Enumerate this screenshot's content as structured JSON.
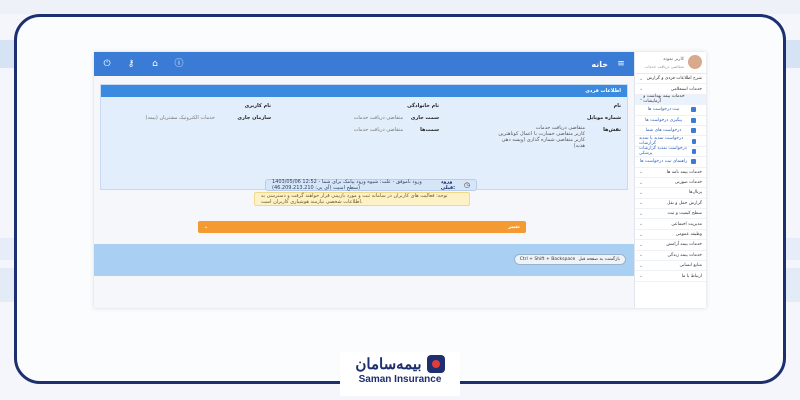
{
  "topbar": {
    "home_title": "خانه",
    "icons": [
      "power-icon",
      "key-icon",
      "home-icon",
      "info-icon"
    ]
  },
  "panel": {
    "title": "اطلاعات فردی",
    "fields": {
      "name_label": "نام",
      "mobile_label": "شماره موبایل",
      "roles_label": "نقش‌ها",
      "family_label": "نام خانوادگی",
      "current_post_label": "سمت جاری",
      "posts_label": "سمت‌ها",
      "username_label": "نام کاربری",
      "current_org_label": "سازمان جاری",
      "current_post_value": "متقاضی دریافت خدمات",
      "posts_value": "متقاضی دریافت خدمات",
      "roles_lines": [
        "متقاضی دریافت خدمات",
        "کاربر متقاضی خسارت با اعمال کوتاهترین",
        "کاربر متقاضی شماره گذاری (ویسه دهی هدیه)"
      ],
      "current_org_value": "خدمات الکترونیک مشتریان (بیمه)"
    },
    "login_label": "ورود قبلی:",
    "login_text": "1403/05/06 12:52 - ورود ناموفق - علت: شیوه ورود پیامک برای شما (سطح امنیت (آی پی: 46.209.213.210)",
    "warning_text": "توجه: فعالیت های کاربران در سامانه ثبت و مورد بازبینی قرار خواهند گرفت و دسترسی به اطلاعات شخصی نیازمند هوشیاری کاربران است."
  },
  "change_bar": {
    "label": "تغییر"
  },
  "back_button": {
    "label": "بازگشت به صفحه قبل",
    "shortcut": "Ctrl + Shift + Backspace"
  },
  "sidebar": {
    "profile_name": "کاربر نمونه",
    "profile_sub": "متقاضی دریافت خدمات",
    "items": [
      {
        "label": "شرح اطلاعات فردی و گزارش",
        "type": "main"
      },
      {
        "label": "خدمات استعلامی",
        "type": "main"
      },
      {
        "label": "خدمات بیمه بهداشت و آزمایشات",
        "type": "main",
        "active": true
      },
      {
        "label": "ثبت درخواست ها",
        "type": "sub"
      },
      {
        "label": "پیگیری درخواست ها",
        "type": "sub"
      },
      {
        "label": "درخواست های شما",
        "type": "sub"
      },
      {
        "label": "درخواست تمدید یا تمدید گزارشات",
        "type": "sub"
      },
      {
        "label": "درخواست تمدید گزارشات پزشکی",
        "type": "sub"
      },
      {
        "label": "راهنمای ثبت درخواست ها",
        "type": "sub"
      },
      {
        "label": "خدمات بیمه نامه ها",
        "type": "main"
      },
      {
        "label": "خدمات صورتی",
        "type": "main"
      },
      {
        "label": "پرتال‌ها",
        "type": "main"
      },
      {
        "label": "گزارش حمل و نقل",
        "type": "main"
      },
      {
        "label": "سطح کیفیت و ثبت",
        "type": "main"
      },
      {
        "label": "مدیریت اجتماعی",
        "type": "main"
      },
      {
        "label": "وظیفه عمومی",
        "type": "main"
      },
      {
        "label": "خدمات بیمه آرامش",
        "type": "main"
      },
      {
        "label": "خدمات بیمه زندگی",
        "type": "main"
      },
      {
        "label": "منابع انسانی",
        "type": "main"
      },
      {
        "label": "ارتباط با ما",
        "type": "main"
      }
    ]
  },
  "logo": {
    "fa_text": "بیمه‌سامان",
    "en_text": "Saman Insurance"
  },
  "colors": {
    "primary": "#3a7bd5",
    "frame": "#1d2f6f",
    "orange": "#f39a32",
    "footer": "#a9cff2"
  }
}
